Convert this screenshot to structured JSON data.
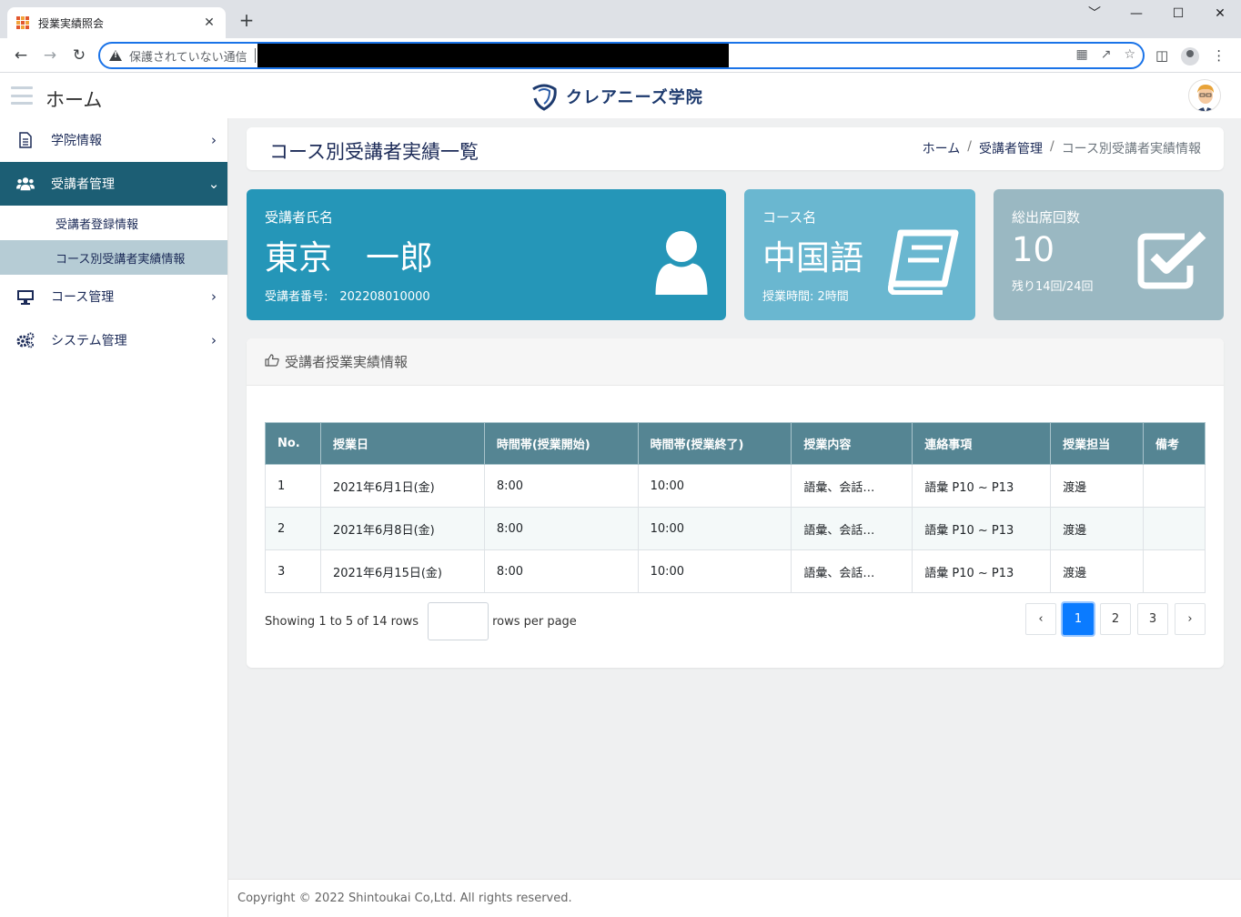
{
  "browser": {
    "tab_title": "授業実績照会",
    "tab_close": "✕",
    "new_tab": "+",
    "window_controls": [
      "﹀",
      "—",
      "☐",
      "✕"
    ],
    "security_label": "保護されていない通信"
  },
  "header": {
    "home_title": "ホーム",
    "brand_name": "クレアニーズ学院"
  },
  "sidebar": {
    "items": [
      {
        "label": "学院情報",
        "icon": "document-icon",
        "arrow": "›"
      },
      {
        "label": "受講者管理",
        "icon": "users-icon",
        "arrow": "⌄"
      },
      {
        "label": "コース管理",
        "icon": "monitor-icon",
        "arrow": "›"
      },
      {
        "label": "システム管理",
        "icon": "gears-icon",
        "arrow": "›"
      }
    ],
    "subitems": [
      {
        "label": "受講者登録情報"
      },
      {
        "label": "コース別受講者実績情報"
      }
    ]
  },
  "page": {
    "title": "コース別受講者実績一覧",
    "breadcrumb": [
      "ホーム",
      "受講者管理",
      "コース別受講者実績情報"
    ],
    "breadcrumb_sep": "/"
  },
  "cards": {
    "student": {
      "label": "受講者氏名",
      "value": "東京　一郎",
      "sub": "受講者番号:　202208010000",
      "icon": "user-icon"
    },
    "course": {
      "label": "コース名",
      "value": "中国語",
      "sub": "授業時間: 2時間",
      "icon": "book-icon"
    },
    "attendance": {
      "label": "総出席回数",
      "value": "10",
      "sub": "残り14回/24回",
      "icon": "checkbox-icon"
    }
  },
  "panel": {
    "title": "受講者授業実績情報",
    "icon": "thumbs-up-icon"
  },
  "table": {
    "headers": [
      "No.",
      "授業日",
      "時間帯(授業開始)",
      "時間帯(授業終了)",
      "授業内容",
      "連絡事項",
      "授業担当",
      "備考"
    ],
    "rows": [
      [
        "1",
        "2021年6月1日(金)",
        "8:00",
        "10:00",
        "語彙、会話…",
        "語彙 P10 ~ P13",
        "渡邊",
        ""
      ],
      [
        "2",
        "2021年6月8日(金)",
        "8:00",
        "10:00",
        "語彙、会話…",
        "語彙 P10 ~ P13",
        "渡邊",
        ""
      ],
      [
        "3",
        "2021年6月15日(金)",
        "8:00",
        "10:00",
        "語彙、会話…",
        "語彙 P10 ~ P13",
        "渡邊",
        ""
      ]
    ]
  },
  "pager": {
    "showing": "Showing 1 to 5 of 14 rows",
    "rows_per_page": "rows per page",
    "prev": "‹",
    "next": "›",
    "pages": [
      "1",
      "2",
      "3"
    ]
  },
  "footer": {
    "copyright": "Copyright © 2022 Shintoukai Co,Ltd. All rights reserved."
  },
  "colors": {
    "sidebar_active": "#1c5e74",
    "card_student": "#2596b8",
    "card_course": "#6ab7d0",
    "card_attendance": "#9ab8c2",
    "table_header": "#558593",
    "page_active": "#0b7bff"
  }
}
